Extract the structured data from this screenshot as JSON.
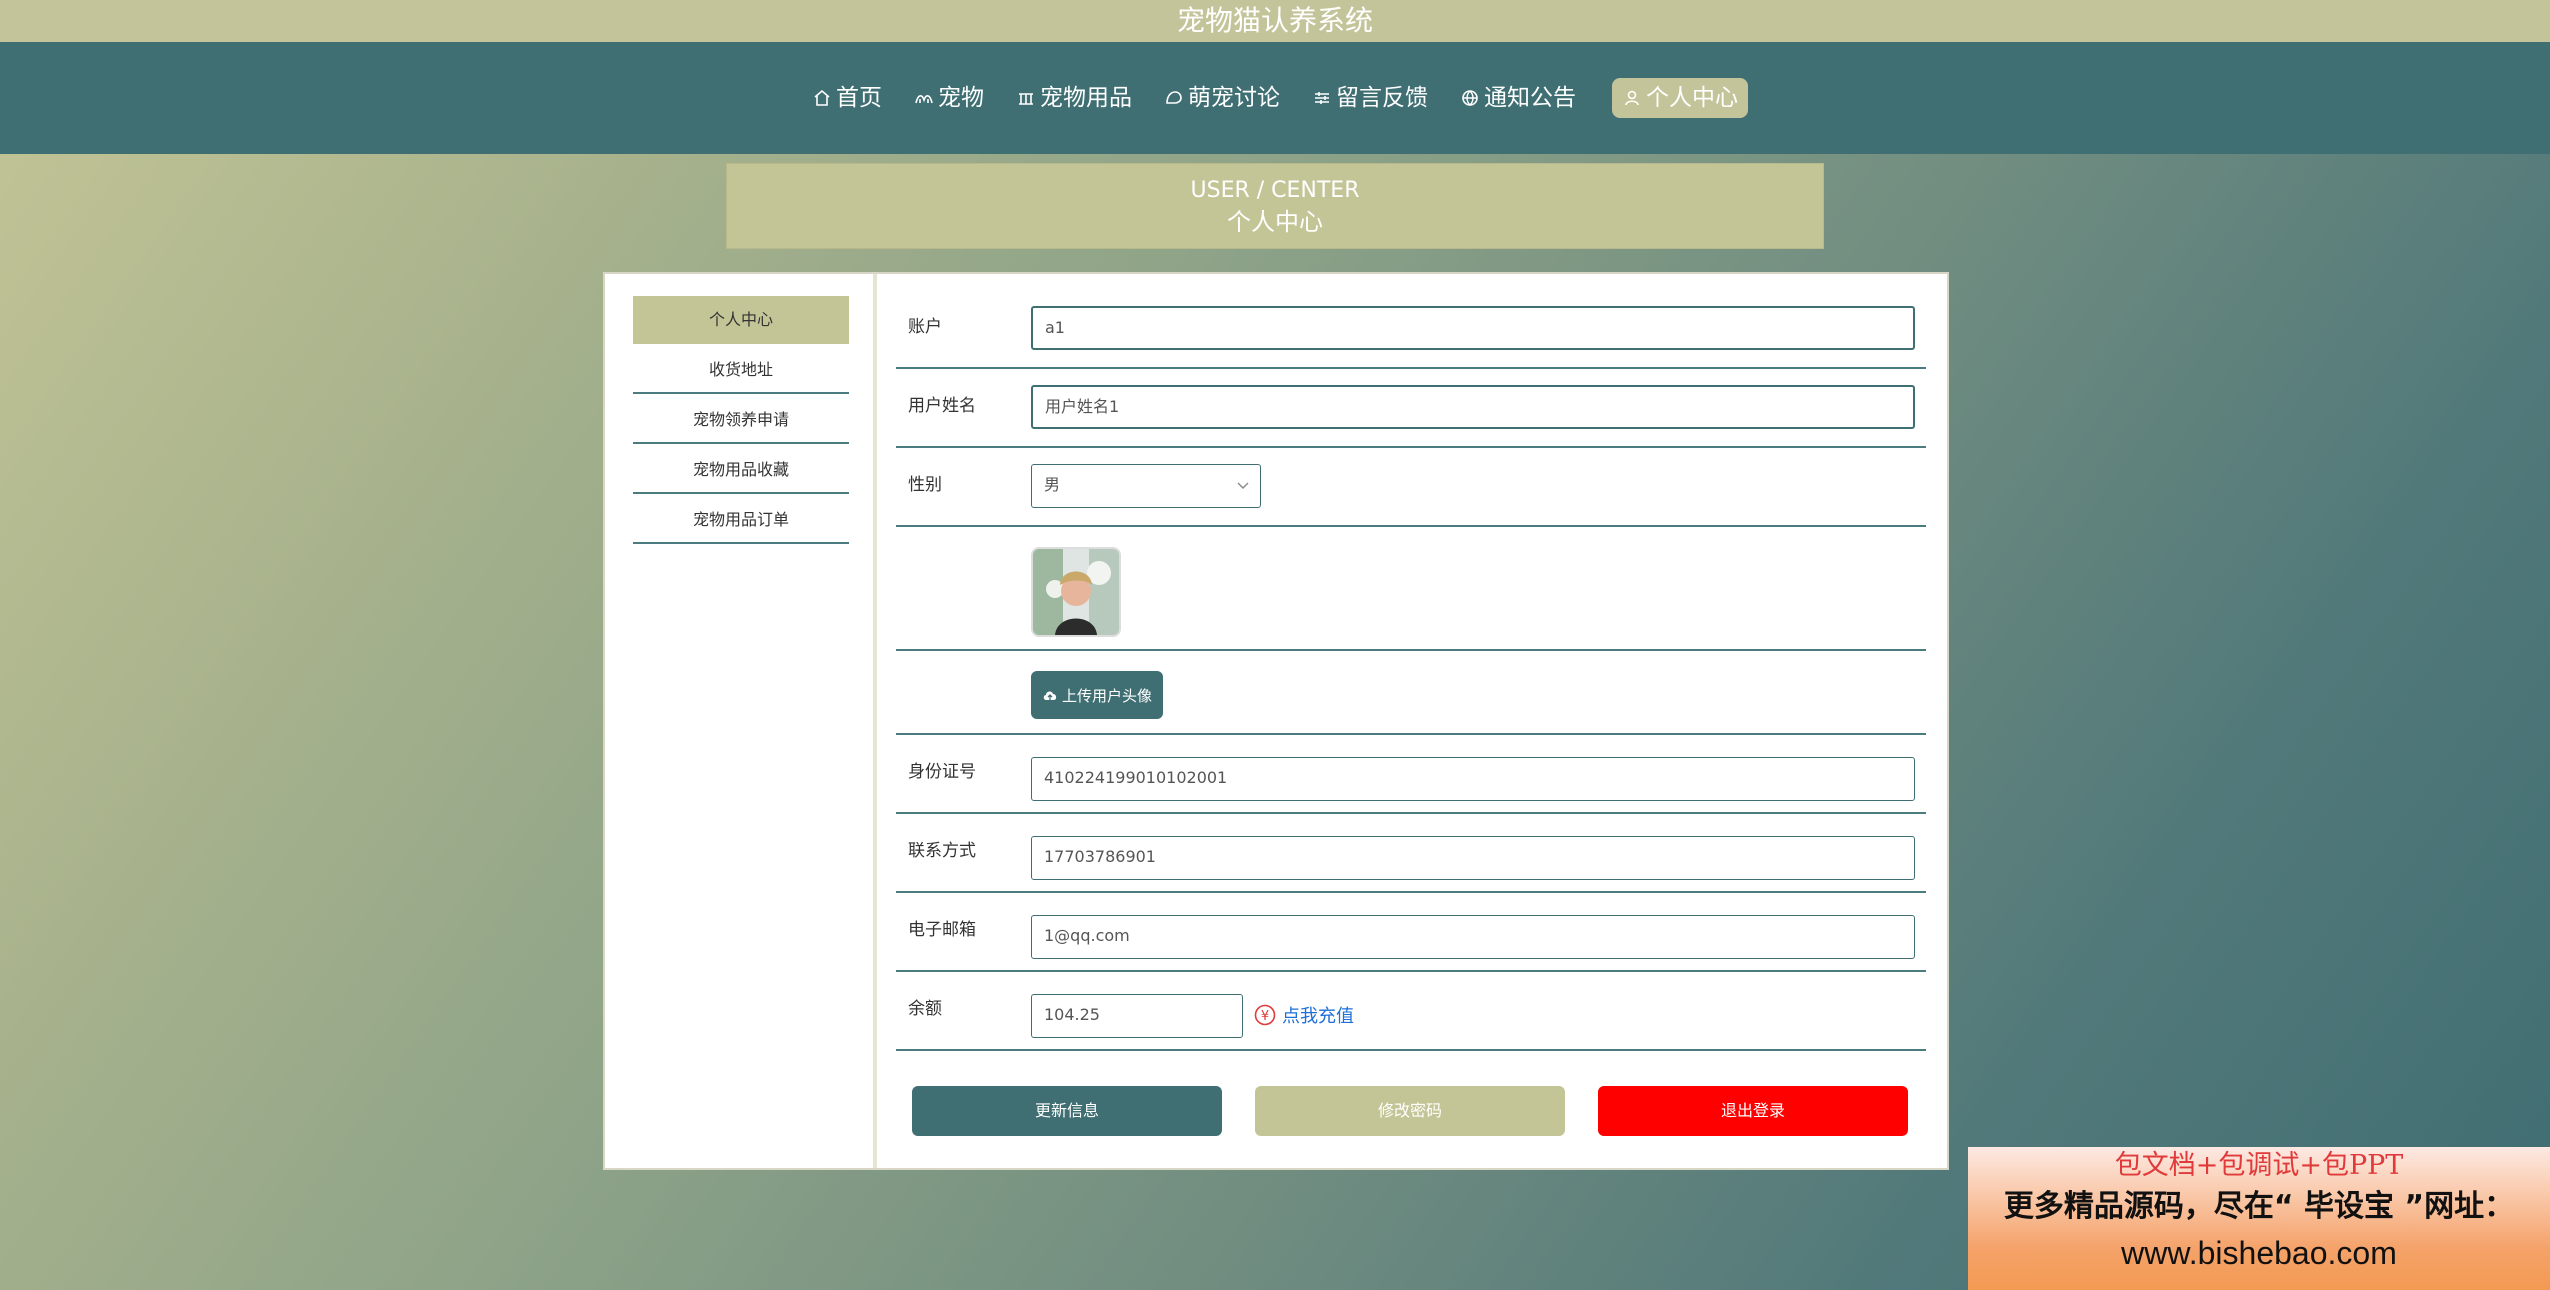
{
  "app": {
    "title": "宠物猫认养系统"
  },
  "nav": {
    "items": [
      {
        "label": "首页",
        "icon": "home-icon"
      },
      {
        "label": "宠物",
        "icon": "pet-icon"
      },
      {
        "label": "宠物用品",
        "icon": "supplies-icon"
      },
      {
        "label": "萌宠讨论",
        "icon": "chat-icon"
      },
      {
        "label": "留言反馈",
        "icon": "feedback-icon"
      },
      {
        "label": "通知公告",
        "icon": "globe-icon"
      },
      {
        "label": "个人中心",
        "icon": "user-icon",
        "active": true
      }
    ]
  },
  "banner": {
    "en": "USER / CENTER",
    "cn": "个人中心"
  },
  "sidebar": {
    "items": [
      {
        "label": "个人中心",
        "active": true
      },
      {
        "label": "收货地址"
      },
      {
        "label": "宠物领养申请"
      },
      {
        "label": "宠物用品收藏"
      },
      {
        "label": "宠物用品订单"
      }
    ]
  },
  "form": {
    "account_label": "账户",
    "account_value": "a1",
    "name_label": "用户姓名",
    "name_value": "用户姓名1",
    "gender_label": "性别",
    "gender_value": "男",
    "upload_label": "上传用户头像",
    "idcard_label": "身份证号",
    "idcard_value": "410224199010102001",
    "phone_label": "联系方式",
    "phone_value": "17703786901",
    "email_label": "电子邮箱",
    "email_value": "1@qq.com",
    "balance_label": "余额",
    "balance_value": "104.25",
    "recharge_label": "点我充值"
  },
  "buttons": {
    "update": "更新信息",
    "password": "修改密码",
    "logout": "退出登录"
  },
  "watermark": {
    "line1": "包文档+包调试+包PPT",
    "line2": "更多精品源码，尽在“ 毕设宝 ”网址：",
    "line3": "www.bishebao.com"
  },
  "colors": {
    "primary": "#3f6f73",
    "accent": "#c4c596",
    "danger": "#ff0000",
    "link": "#1e6fd9"
  }
}
